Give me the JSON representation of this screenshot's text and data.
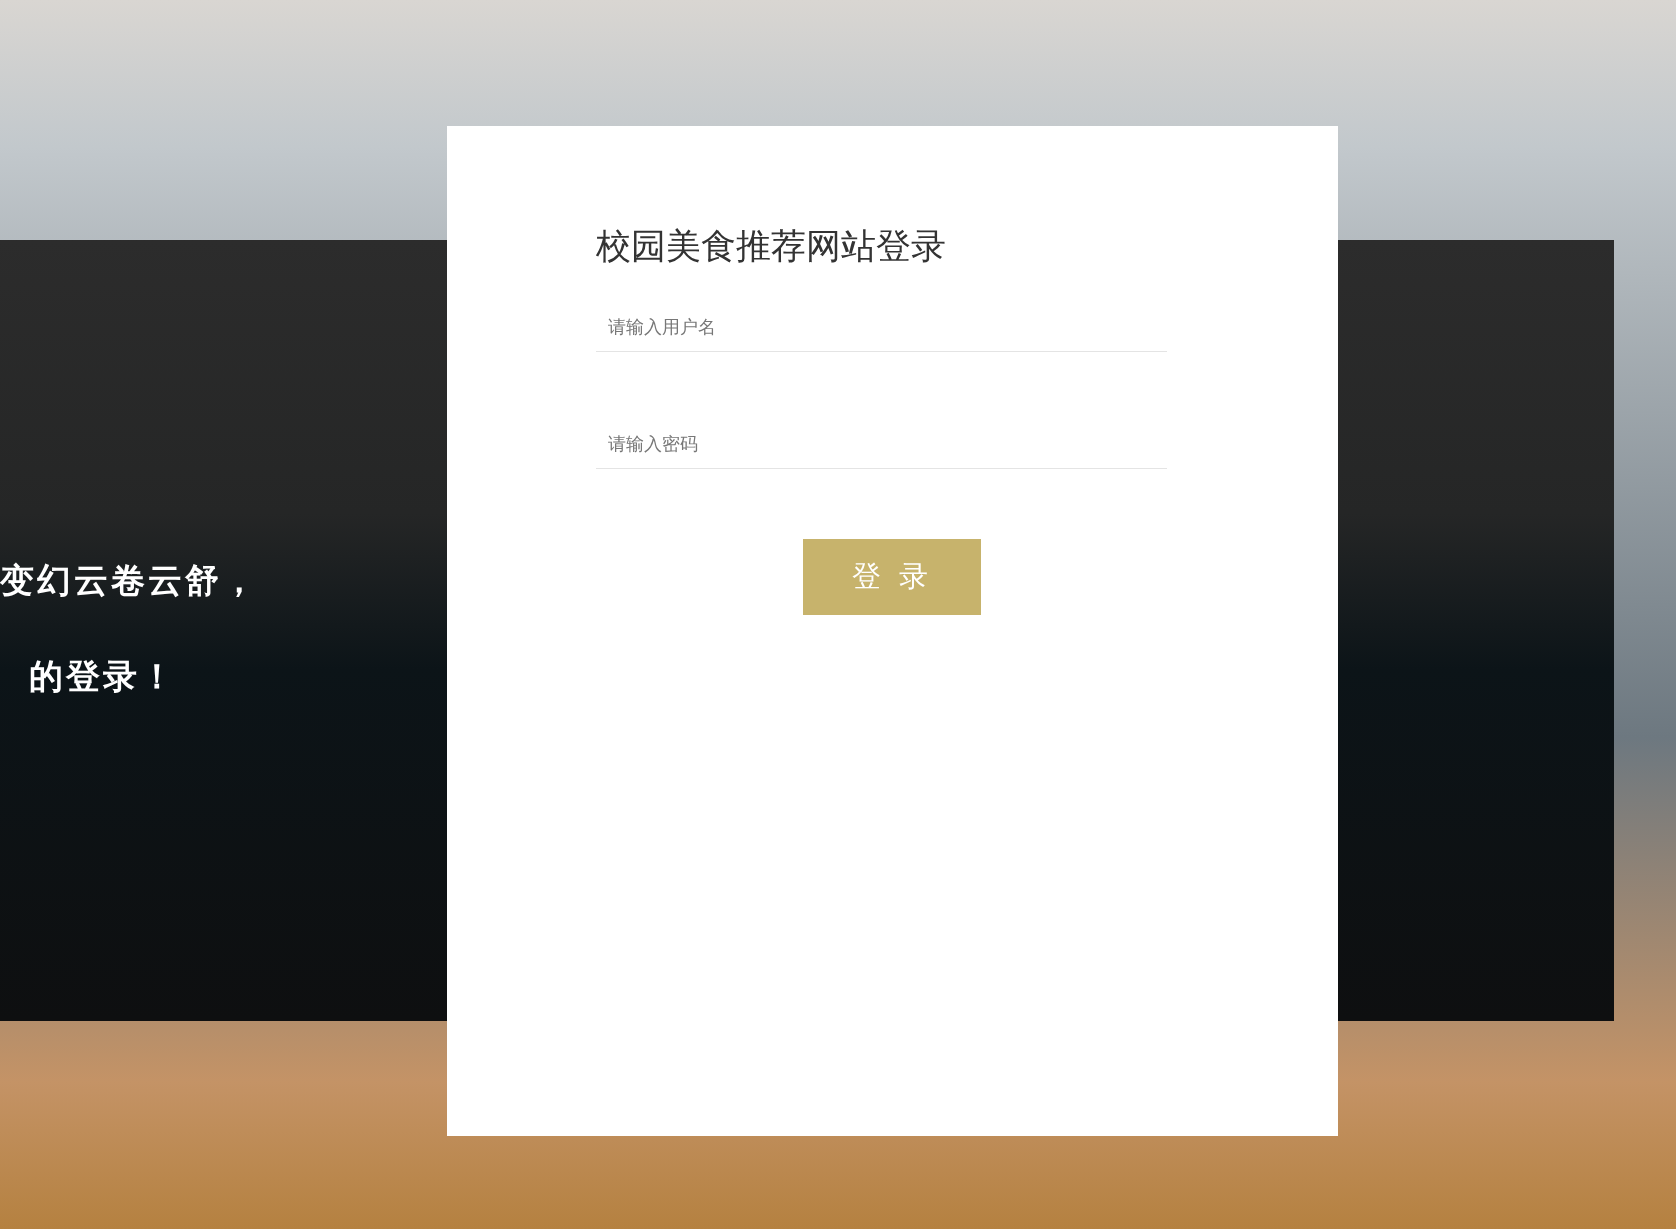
{
  "slogan": {
    "lines": [
      "变幻云卷云舒，",
      "的登录！"
    ]
  },
  "login_card": {
    "title": "校园美食推荐网站登录",
    "fields": [
      {
        "placeholder": "请输入用户名"
      },
      {
        "placeholder": "请输入密码"
      }
    ],
    "button": "登 录"
  }
}
